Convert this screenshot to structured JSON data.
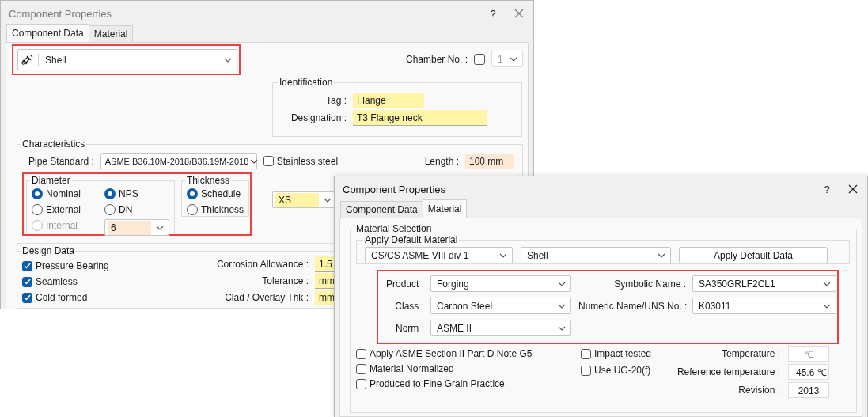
{
  "back_window": {
    "title": "Component Properties",
    "active": false,
    "help": "?",
    "tabs": [
      {
        "label": "Component Data",
        "selected": true
      },
      {
        "label": "Material",
        "selected": false
      }
    ],
    "component": {
      "value": "Shell",
      "highlighted": true
    },
    "chamber": {
      "label": "Chamber No. :",
      "checked": false,
      "value": "1"
    },
    "identification": {
      "title": "Identification",
      "fields": [
        {
          "label": "Tag :",
          "value": "Flange"
        },
        {
          "label": "Designation :",
          "value": "T3 Flange neck"
        }
      ]
    },
    "characteristics": {
      "title": "Characteristics",
      "pipe_standard": {
        "label": "Pipe Standard :",
        "value": "ASME B36.10M-2018/B36.19M-2018"
      },
      "stainless": {
        "label": "Stainless steel",
        "checked": false
      },
      "length": {
        "label": "Length :",
        "value": "100 mm"
      },
      "highlighted": true,
      "diameter": {
        "title": "Diameter",
        "options": [
          {
            "label": "Nominal",
            "selected": true,
            "disabled": false
          },
          {
            "label": "External",
            "selected": false,
            "disabled": false
          },
          {
            "label": "Internal",
            "selected": false,
            "disabled": true
          }
        ],
        "units": [
          {
            "label": "NPS",
            "selected": true
          },
          {
            "label": "DN",
            "selected": false
          }
        ],
        "size": "6"
      },
      "thickness": {
        "title": "Thickness",
        "options": [
          {
            "label": "Schedule",
            "selected": true
          },
          {
            "label": "Thickness",
            "selected": false
          }
        ]
      },
      "schedule": "XS"
    },
    "design_data": {
      "title": "Design Data",
      "checks": [
        {
          "label": "Pressure Bearing",
          "checked": true
        },
        {
          "label": "Seamless",
          "checked": true
        },
        {
          "label": "Cold formed",
          "checked": true
        }
      ],
      "fields": [
        {
          "label": "Corrosion Allowance :",
          "value": "1.5"
        },
        {
          "label": "Tolerance :",
          "value": "mm"
        },
        {
          "label": "Clad / Overlay Thk :",
          "value": "mm"
        }
      ]
    }
  },
  "front_window": {
    "title": "Component Properties",
    "active": true,
    "help": "?",
    "tabs": [
      {
        "label": "Component Data",
        "selected": false
      },
      {
        "label": "Material",
        "selected": true
      }
    ],
    "material_selection": {
      "title": "Material Selection",
      "defaults": {
        "title": "Apply Default Material",
        "code": "CS/CS ASME VIII div 1",
        "part": "Shell",
        "button": "Apply Default Data"
      },
      "highlighted": true,
      "left_fields": [
        {
          "label": "Product :",
          "value": "Forging"
        },
        {
          "label": "Class :",
          "value": "Carbon Steel"
        },
        {
          "label": "Norm :",
          "value": "ASME II"
        }
      ],
      "right_fields": [
        {
          "label": "Symbolic Name :",
          "value": "SA350GRLF2CL1"
        },
        {
          "label": "Numeric Name/UNS No. :",
          "value": "K03011"
        }
      ],
      "checks_left": [
        {
          "label": "Apply ASME Section II Part D Note G5",
          "checked": false
        },
        {
          "label": "Material Normalized",
          "checked": false
        },
        {
          "label": "Produced to Fine Grain Practice",
          "checked": false
        }
      ],
      "checks_middle": [
        {
          "label": "Impact tested",
          "checked": false
        },
        {
          "label": "Use UG-20(f)",
          "checked": false
        }
      ],
      "values": [
        {
          "label": "Temperature :",
          "value": "℃",
          "disabled": true
        },
        {
          "label": "Reference temperature :",
          "value": "-45.6 ℃",
          "disabled": false
        },
        {
          "label": "Revision :",
          "value": "2013",
          "disabled": false
        }
      ]
    }
  }
}
